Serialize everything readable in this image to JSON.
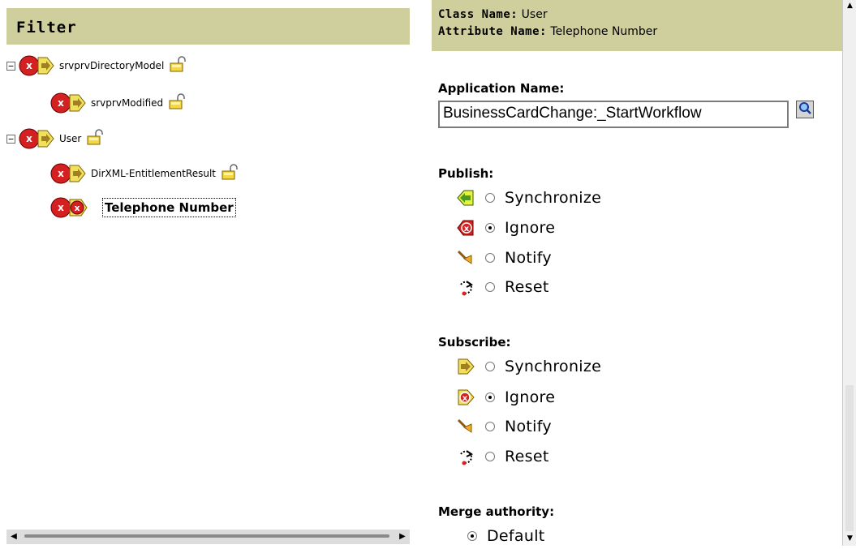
{
  "filter": {
    "title": "Filter",
    "tree": [
      {
        "label": "srvprvDirectoryModel",
        "expander": "−"
      },
      {
        "label": "srvprvModified"
      },
      {
        "label": "User",
        "expander": "−"
      },
      {
        "label": "DirXML-EntitlementResult"
      },
      {
        "label": "Telephone Number",
        "selected": true
      }
    ]
  },
  "scroll": {
    "left_arrow": "◀",
    "right_arrow": "▶",
    "up_arrow": "▲",
    "down_arrow": "▼"
  },
  "detail": {
    "class_name_label": "Class Name:",
    "class_name_value": "User",
    "attribute_name_label": "Attribute Name:",
    "attribute_name_value": "Telephone Number",
    "application_name_label": "Application Name:",
    "application_name_value": "BusinessCardChange:_StartWorkflow",
    "publish_label": "Publish:",
    "publish_options": [
      {
        "label": "Synchronize",
        "icon": "publish-sync-icon",
        "selected": false
      },
      {
        "label": "Ignore",
        "icon": "publish-ignore-icon",
        "selected": true
      },
      {
        "label": "Notify",
        "icon": "notify-bell-icon",
        "selected": false
      },
      {
        "label": "Reset",
        "icon": "reset-icon",
        "selected": false
      }
    ],
    "subscribe_label": "Subscribe:",
    "subscribe_options": [
      {
        "label": "Synchronize",
        "icon": "subscribe-sync-icon",
        "selected": false
      },
      {
        "label": "Ignore",
        "icon": "subscribe-ignore-icon",
        "selected": true
      },
      {
        "label": "Notify",
        "icon": "notify-bell-icon",
        "selected": false
      },
      {
        "label": "Reset",
        "icon": "reset-icon",
        "selected": false
      }
    ],
    "merge_authority_label": "Merge authority:",
    "merge_options": [
      {
        "label": "Default",
        "selected": true
      }
    ]
  },
  "colors": {
    "header_bg": "#cfcf9e",
    "ignore_red": "#d42020",
    "sync_yellow": "#f0e060",
    "sync_green": "#9acd32"
  }
}
